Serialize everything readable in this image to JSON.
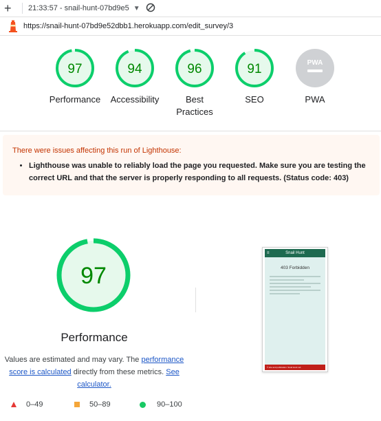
{
  "topbar": {
    "new_tab_icon": "plus-icon",
    "title": "21:33:57 - snail-hunt-07bd9e5",
    "dropdown_icon": "chevron-down-icon",
    "block_icon": "no-entry-icon"
  },
  "urlbar": {
    "logo_icon": "lighthouse-icon",
    "url": "https://snail-hunt-07bd9e52dbb1.herokuapp.com/edit_survey/3"
  },
  "gauges": [
    {
      "score": "97",
      "label": "Performance",
      "fraction": 0.97
    },
    {
      "score": "94",
      "label": "Accessibility",
      "fraction": 0.94
    },
    {
      "score": "96",
      "label": "Best Practices",
      "fraction": 0.96
    },
    {
      "score": "91",
      "label": "SEO",
      "fraction": 0.91
    },
    {
      "score": "PWA",
      "label": "PWA",
      "fraction": 0
    }
  ],
  "warning": {
    "title": "There were issues affecting this run of Lighthouse:",
    "items": [
      "Lighthouse was unable to reliably load the page you requested. Make sure you are testing the correct URL and that the server is properly responding to all requests. (Status code: 403)"
    ]
  },
  "performance": {
    "score": "97",
    "fraction": 0.97,
    "title": "Performance",
    "estimate_pre": "Values are estimated and may vary. The ",
    "estimate_link": "performance score is calculated",
    "estimate_mid": " directly from these metrics. ",
    "calculator_link": "See calculator."
  },
  "screenshot": {
    "app_title": "Snail Hunt",
    "heading": "403 Forbidden",
    "footer": "© site and publication: Snail Hunt Ltd"
  },
  "legend": [
    {
      "icon": "triangle-red-icon",
      "label": "0–49"
    },
    {
      "icon": "square-orange-icon",
      "label": "50–89"
    },
    {
      "icon": "circle-green-icon",
      "label": "90–100"
    }
  ],
  "colors": {
    "pass": "#0cce6b",
    "pass_text": "#008800",
    "pass_fill": "#e6f9ec",
    "pwa": "#cfd1d4",
    "warning_text": "#c33300",
    "link": "#1a55c6"
  }
}
